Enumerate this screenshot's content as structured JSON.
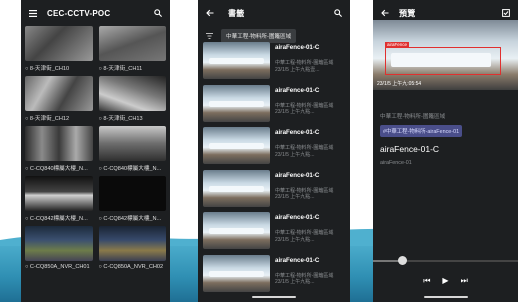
{
  "phone1": {
    "title": "CEC-CCTV-POC",
    "cameras": [
      {
        "label": "○ 8-天津街_CH10"
      },
      {
        "label": "○ 8-天津街_CH11"
      },
      {
        "label": "○ 8-天津街_CH12"
      },
      {
        "label": "○ 8-天津街_CH13"
      },
      {
        "label": "○ C-CQ840標屬大樓_N..."
      },
      {
        "label": "○ C-CQ840標屬大樓_N..."
      },
      {
        "label": "○ C-CQ842標屬大樓_N..."
      },
      {
        "label": "○ C-CQ842標屬大樓_N..."
      },
      {
        "label": "○ C-CQ850A_NVR_CH01"
      },
      {
        "label": "○ C-CQ850A_NVR_CH02"
      }
    ]
  },
  "phone2": {
    "title": "書籤",
    "chip": "中華工程-物料所-圍籬區域",
    "items": [
      {
        "name": "airaFence-01-C",
        "sub1": "中華工程-物料所-圍籬區域",
        "sub2": "23/1/5 上午九點壹..."
      },
      {
        "name": "airaFence-01-C",
        "sub1": "中華工程-物料所-圍籬區域",
        "sub2": "23/1/5 上午九點..."
      },
      {
        "name": "airaFence-01-C",
        "sub1": "中華工程-物料所-圍籬區域",
        "sub2": "23/1/5 上午九點..."
      },
      {
        "name": "airaFence-01-C",
        "sub1": "中華工程-物料所-圍籬區域",
        "sub2": "23/1/5 上午九點..."
      },
      {
        "name": "airaFence-01-C",
        "sub1": "中華工程-物料所-圍籬區域",
        "sub2": "23/1/5 上午九點..."
      },
      {
        "name": "airaFence-01-C",
        "sub1": "中華工程-物料所-圍籬區域",
        "sub2": "23/1/5 上午九點..."
      }
    ]
  },
  "phone3": {
    "title": "預覽",
    "timestamp": "23/1/5 上午九:05:54",
    "box_label": "airaFence",
    "site": "中華工程-物料所-圍籬區域",
    "chip": "#中華工程-物料所-airaFence-01",
    "name": "airaFence-01-C",
    "sub": "airaFence-01",
    "progress": 0.2
  },
  "colors": {
    "screen_bg": "#1d1f21",
    "chip_bg": "#3a3d40",
    "detect_box": "#e0302f",
    "tag_bg": "#4a4e8a"
  }
}
